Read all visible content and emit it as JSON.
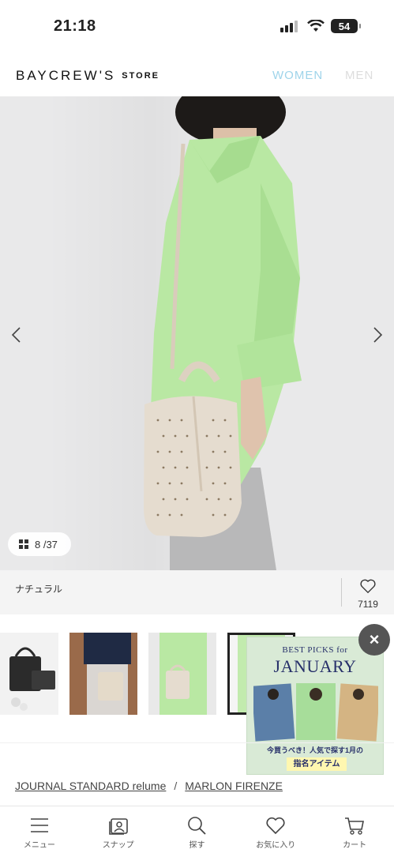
{
  "status": {
    "time": "21:18",
    "battery": "54"
  },
  "header": {
    "logo": "BAYCREW'S",
    "logo_sub": "STORE",
    "nav": [
      "WOMEN",
      "MEN"
    ],
    "active_color": "#9fd4ea"
  },
  "gallery": {
    "counter": "8 /37"
  },
  "product": {
    "color_label": "ナチュラル",
    "favorite_count": "7119"
  },
  "promo": {
    "line1": "BEST PICKS for",
    "line2": "JANUARY",
    "subtitle": "今買うべき！人気で探す1月の",
    "badge": "指名アイテム",
    "close_label": "×"
  },
  "breadcrumb": {
    "items": [
      "JOURNAL STANDARD relume",
      "MARLON FIRENZE"
    ],
    "separator": "/"
  },
  "bottom_nav": {
    "items": [
      {
        "label": "メニュー",
        "icon": "menu-icon"
      },
      {
        "label": "スナップ",
        "icon": "snap-icon"
      },
      {
        "label": "探す",
        "icon": "search-icon"
      },
      {
        "label": "お気に入り",
        "icon": "heart-icon"
      },
      {
        "label": "カート",
        "icon": "cart-icon"
      }
    ]
  }
}
